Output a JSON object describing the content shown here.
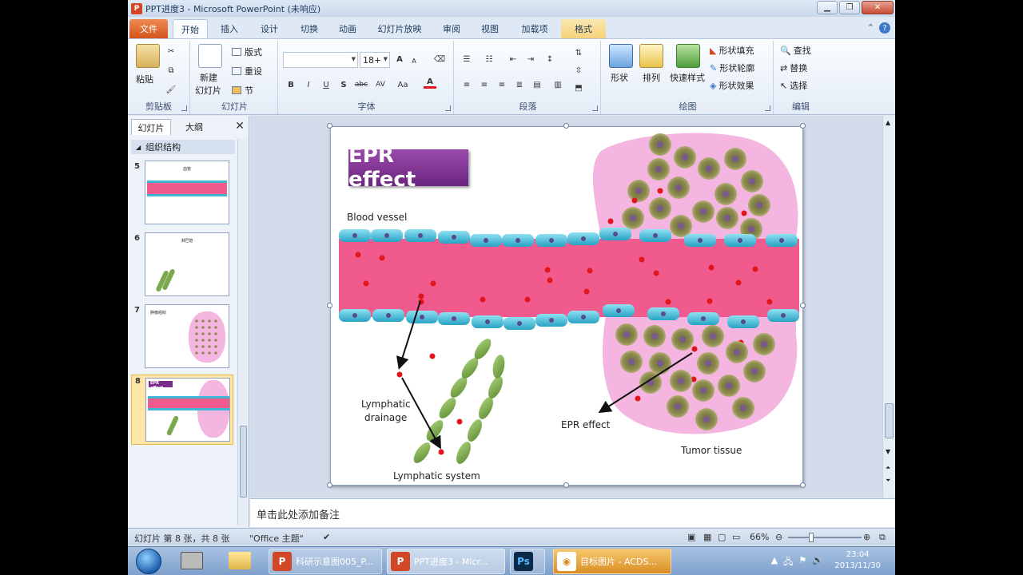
{
  "window": {
    "app_icon": "powerpoint-icon",
    "title": "PPT进度3 - Microsoft PowerPoint (未响应)",
    "buttons": [
      "minimize",
      "restore",
      "close"
    ]
  },
  "ribbon_tabs": [
    "文件",
    "开始",
    "插入",
    "设计",
    "切换",
    "动画",
    "幻灯片放映",
    "审阅",
    "视图",
    "加载项",
    "格式"
  ],
  "ribbon": {
    "clipboard": {
      "paste": "粘贴",
      "label": "剪贴板"
    },
    "slides": {
      "new_slide_1": "新建",
      "new_slide_2": "幻灯片",
      "layout": "版式",
      "reset": "重设",
      "section": "节",
      "label": "幻灯片"
    },
    "font": {
      "font_name": "",
      "font_size": "18+",
      "bold": "B",
      "italic": "I",
      "underline": "U",
      "shadow": "S",
      "strike": "abc",
      "spacing": "AV",
      "case": "Aa",
      "color": "A",
      "grow": "A",
      "shrink": "A",
      "label": "字体"
    },
    "paragraph": {
      "label": "段落"
    },
    "drawing": {
      "shapes": "形状",
      "arrange": "排列",
      "quick_styles": "快速样式",
      "fill": "形状填充",
      "outline": "形状轮廓",
      "effects": "形状效果",
      "label": "绘图"
    },
    "editing": {
      "find": "查找",
      "replace": "替换",
      "select": "选择",
      "label": "编辑"
    }
  },
  "left_panel": {
    "tabs": [
      "幻灯片",
      "大纲"
    ],
    "section": "组织结构",
    "slides": [
      {
        "num": "5",
        "title": "血管"
      },
      {
        "num": "6",
        "title": "淋巴管"
      },
      {
        "num": "7",
        "title": "肿瘤组织"
      },
      {
        "num": "8",
        "title": "EPR effect"
      }
    ]
  },
  "slide": {
    "title": "EPR effect",
    "labels": {
      "blood_vessel": "Blood vessel",
      "lymphatic_drainage_1": "Lymphatic",
      "lymphatic_drainage_2": "drainage",
      "lymphatic_system": "Lymphatic system",
      "epr_effect": "EPR effect",
      "tumor_tissue": "Tumor tissue"
    },
    "colors": {
      "title_bg": "#7b2d8b",
      "vessel": "#f05a8c",
      "endothelial": "#3fb7d4",
      "tumor_bg": "#f4b6e0",
      "tumor_cell": "#8c8a4e",
      "lymph": "#7aa84a",
      "particle": "#e0161c"
    }
  },
  "notes": {
    "placeholder": "单击此处添加备注"
  },
  "statusbar": {
    "slide_info": "幻灯片 第 8 张，共 8 张",
    "theme": "\"Office 主题\"",
    "zoom": "66%"
  },
  "taskbar": {
    "buttons": [
      {
        "label": "科研示意图005_P...",
        "icon": "powerpoint-icon"
      },
      {
        "label": "PPT进度3 - Micr...",
        "icon": "powerpoint-icon"
      },
      {
        "label": "",
        "icon": "photoshop-icon"
      },
      {
        "label": "目标图片 - ACDS...",
        "icon": "acdsee-icon"
      }
    ],
    "time": "23:04",
    "date": "2013/11/30"
  }
}
